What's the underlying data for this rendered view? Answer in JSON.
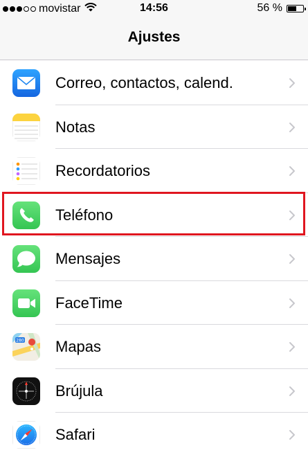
{
  "status_bar": {
    "carrier": "movistar",
    "time": "14:56",
    "battery_text": "56 %",
    "battery_level": 0.56,
    "signal_bars_filled": 3,
    "signal_bars_total": 5
  },
  "nav": {
    "title": "Ajustes"
  },
  "settings": [
    {
      "label": "Correo, contactos, calend.",
      "icon": "mail-icon"
    },
    {
      "label": "Notas",
      "icon": "notes-icon"
    },
    {
      "label": "Recordatorios",
      "icon": "reminders-icon"
    },
    {
      "label": "Teléfono",
      "icon": "phone-icon"
    },
    {
      "label": "Mensajes",
      "icon": "messages-icon"
    },
    {
      "label": "FaceTime",
      "icon": "facetime-icon"
    },
    {
      "label": "Mapas",
      "icon": "maps-icon"
    },
    {
      "label": "Brújula",
      "icon": "compass-icon"
    },
    {
      "label": "Safari",
      "icon": "safari-icon"
    }
  ],
  "colors": {
    "highlight": "#e0161f",
    "mail": "#1e86f0",
    "phone": "#4cd964",
    "chevron": "#c7c7cc"
  }
}
